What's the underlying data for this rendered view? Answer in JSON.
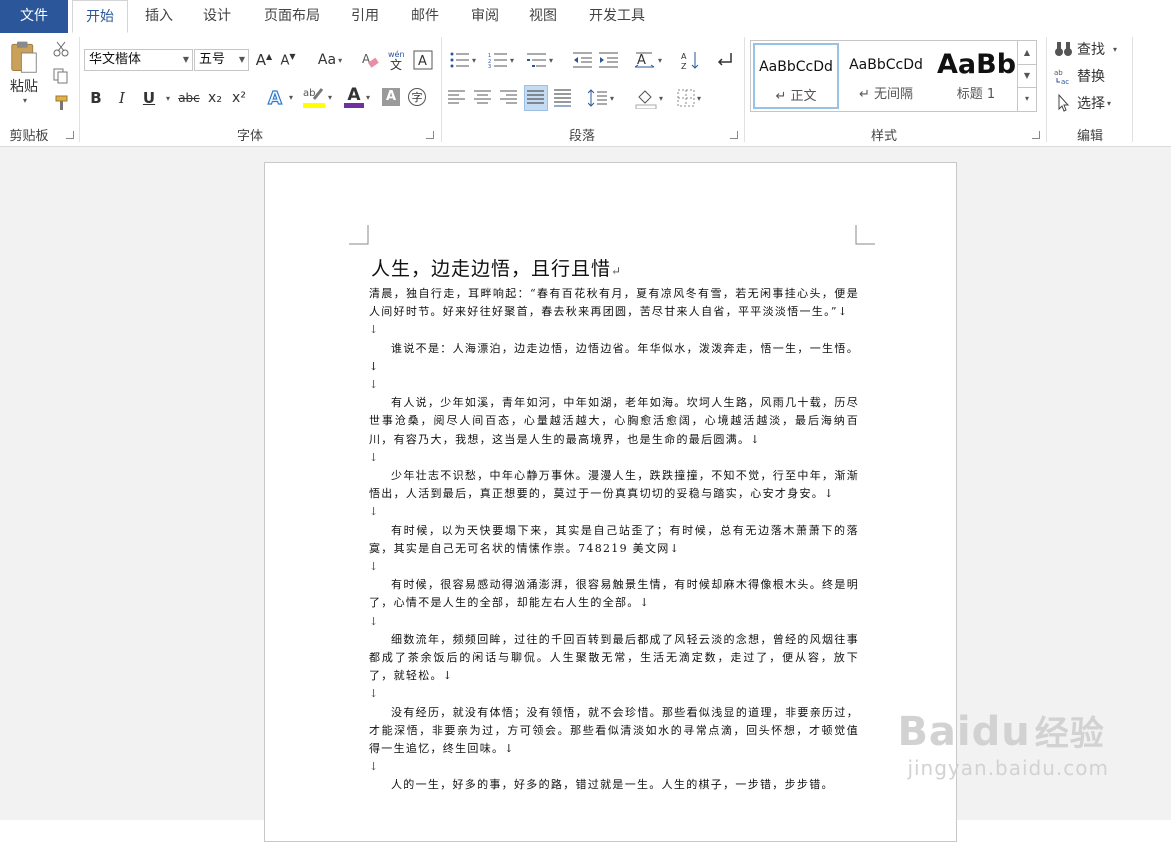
{
  "tabs": {
    "file": "文件",
    "home": "开始",
    "insert": "插入",
    "design": "设计",
    "layout": "页面布局",
    "references": "引用",
    "mailings": "邮件",
    "review": "审阅",
    "view": "视图",
    "developer": "开发工具"
  },
  "clipboard": {
    "paste": "粘贴",
    "group": "剪贴板"
  },
  "font": {
    "name": "华文楷体",
    "size": "五号",
    "change_case": "Aa",
    "group": "字体",
    "phonetic": "wén\n文",
    "bold": "B",
    "italic": "I",
    "underline": "U",
    "strike": "abc",
    "sub": "x₂",
    "sup": "x²",
    "color_letter": "A",
    "shading_letter": "A"
  },
  "paragraph": {
    "group": "段落"
  },
  "styles": {
    "group": "样式",
    "items": [
      {
        "preview": "AaBbCcDd",
        "name": "↵ 正文"
      },
      {
        "preview": "AaBbCcDd",
        "name": "↵ 无间隔"
      },
      {
        "preview": "AaBb",
        "name": "标题 1"
      }
    ]
  },
  "editing": {
    "find": "查找",
    "replace": "替换",
    "select": "选择",
    "group": "编辑"
  },
  "document": {
    "title": "人生，边走边悟，且行且惜",
    "title_mark": "↵",
    "paragraphs": [
      {
        "text": "清晨，独自行走，耳畔响起：“春有百花秋有月，夏有凉风冬有雪，若无闲事挂心头，便是人间好时节。好来好往好聚首，春去秋来再团圆，苦尽甘来人自省，平平淡淡悟一生。”↓",
        "indent": false
      },
      {
        "text": "↓",
        "blank": true
      },
      {
        "text": "谁说不是：人海漂泊，边走边悟，边悟边省。年华似水，泼泼奔走，悟一生，一生悟。↓",
        "indent": true
      },
      {
        "text": "↓",
        "blank": true
      },
      {
        "text": "有人说，少年如溪，青年如河，中年如湖，老年如海。坎坷人生路，风雨几十载，历尽世事沧桑，阅尽人间百态，心量越活越大，心胸愈活愈阔，心境越活越淡，最后海纳百川，有容乃大，我想，这当是人生的最高境界，也是生命的最后圆满。↓",
        "indent": true
      },
      {
        "text": "↓",
        "blank": true
      },
      {
        "text": "少年壮志不识愁，中年心静万事休。漫漫人生，跌跌撞撞，不知不觉，行至中年，渐渐悟出，人活到最后，真正想要的，莫过于一份真真切切的妥稳与踏实，心安才身安。↓",
        "indent": true
      },
      {
        "text": "↓",
        "blank": true
      },
      {
        "text": "有时候，以为天快要塌下来，其实是自己站歪了；有时候，总有无边落木萧萧下的落寞，其实是自己无可名状的情愫作祟。748219 美文网↓",
        "indent": true
      },
      {
        "text": "↓",
        "blank": true
      },
      {
        "text": "有时候，很容易感动得汹涌澎湃，很容易触景生情，有时候却麻木得像根木头。终是明了，心情不是人生的全部，却能左右人生的全部。↓",
        "indent": true
      },
      {
        "text": "↓",
        "blank": true
      },
      {
        "text": "细数流年，频频回眸，过往的千回百转到最后都成了风轻云淡的念想，曾经的风烟往事都成了茶余饭后的闲话与聊侃。人生聚散无常，生活无滴定数，走过了，便从容，放下了，就轻松。↓",
        "indent": true
      },
      {
        "text": "↓",
        "blank": true
      },
      {
        "text": "没有经历，就没有体悟；没有领悟，就不会珍惜。那些看似浅显的道理，非要亲历过，才能深悟，非要亲为过，方可领会。那些看似清淡如水的寻常点滴，回头怀想，才顿觉值得一生追忆，终生回味。↓",
        "indent": true
      },
      {
        "text": "↓",
        "blank": true
      },
      {
        "text": "人的一生，好多的事，好多的路，错过就是一生。人生的棋子，一步错，步步错。",
        "indent": true
      }
    ]
  },
  "watermark": {
    "brand": "Baidu",
    "brand_cn": "经验",
    "url": "jingyan.baidu.com"
  }
}
